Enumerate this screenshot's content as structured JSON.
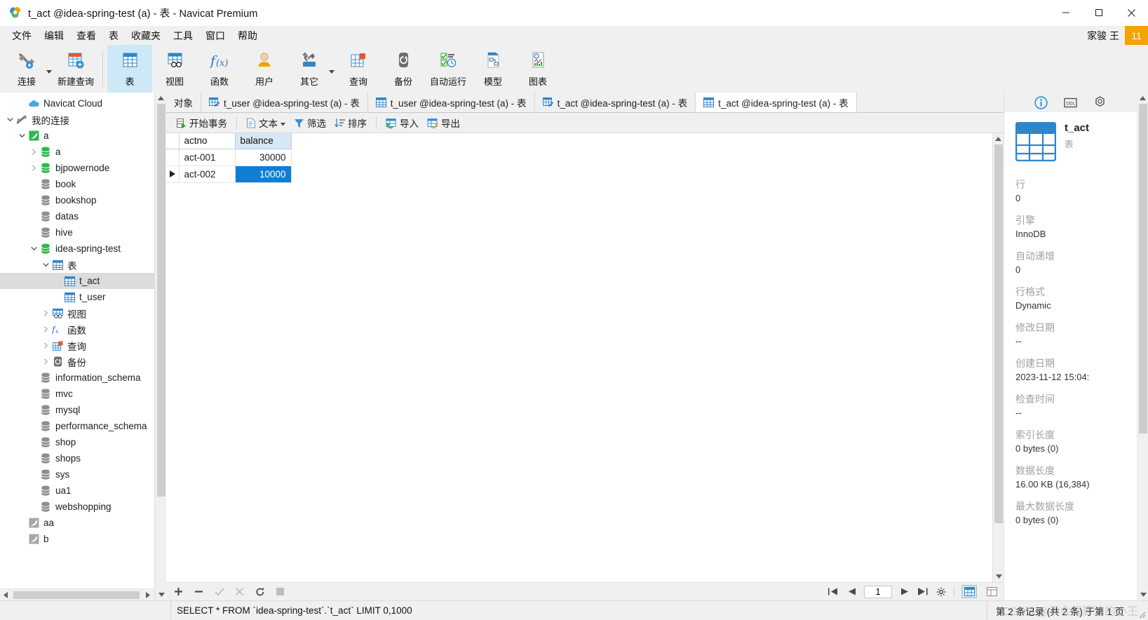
{
  "window": {
    "title": "t_act @idea-spring-test (a) - 表 - Navicat Premium",
    "minimize": "minimize-button",
    "maximize": "maximize-button",
    "close": "close-button"
  },
  "menubar": {
    "items": [
      "文件",
      "编辑",
      "查看",
      "表",
      "收藏夹",
      "工具",
      "窗口",
      "帮助"
    ],
    "user_name": "家骏 王",
    "user_badge": "11"
  },
  "toolbar": {
    "groups": [
      [
        {
          "label": "连接",
          "icon": "connection-icon",
          "caret": true,
          "active": false
        },
        {
          "label": "新建查询",
          "icon": "new-query-icon",
          "caret": false,
          "active": false
        }
      ],
      [
        {
          "label": "表",
          "icon": "table-icon",
          "caret": false,
          "active": true
        },
        {
          "label": "视图",
          "icon": "view-icon",
          "caret": false,
          "active": false
        },
        {
          "label": "函数",
          "icon": "function-icon",
          "caret": false,
          "active": false
        },
        {
          "label": "用户",
          "icon": "user-icon",
          "caret": false,
          "active": false
        },
        {
          "label": "其它",
          "icon": "other-tools-icon",
          "caret": true,
          "active": false
        },
        {
          "label": "查询",
          "icon": "query-icon",
          "caret": false,
          "active": false
        },
        {
          "label": "备份",
          "icon": "backup-icon",
          "caret": false,
          "active": false
        },
        {
          "label": "自动运行",
          "icon": "automation-icon",
          "caret": false,
          "active": false
        },
        {
          "label": "模型",
          "icon": "model-icon",
          "caret": false,
          "active": false
        },
        {
          "label": "图表",
          "icon": "chart-icon",
          "caret": false,
          "active": false
        }
      ]
    ]
  },
  "sidebar": {
    "tree": [
      {
        "label": "Navicat Cloud",
        "indent": 1,
        "icon": "cloud-icon",
        "twist": "none",
        "selected": false
      },
      {
        "label": "我的连接",
        "indent": 0,
        "icon": "connections-icon",
        "twist": "down",
        "selected": false
      },
      {
        "label": "a",
        "indent": 1,
        "icon": "mysql-connection-icon",
        "twist": "down",
        "selected": false
      },
      {
        "label": "a",
        "indent": 2,
        "icon": "database-green-icon",
        "twist": "right",
        "selected": false
      },
      {
        "label": "bjpowernode",
        "indent": 2,
        "icon": "database-green-icon",
        "twist": "right",
        "selected": false
      },
      {
        "label": "book",
        "indent": 2,
        "icon": "database-gray-icon",
        "twist": "none",
        "selected": false
      },
      {
        "label": "bookshop",
        "indent": 2,
        "icon": "database-gray-icon",
        "twist": "none",
        "selected": false
      },
      {
        "label": "datas",
        "indent": 2,
        "icon": "database-gray-icon",
        "twist": "none",
        "selected": false
      },
      {
        "label": "hive",
        "indent": 2,
        "icon": "database-gray-icon",
        "twist": "none",
        "selected": false
      },
      {
        "label": "idea-spring-test",
        "indent": 2,
        "icon": "database-green-icon",
        "twist": "down",
        "selected": false
      },
      {
        "label": "表",
        "indent": 3,
        "icon": "tables-folder-icon",
        "twist": "down",
        "selected": false
      },
      {
        "label": "t_act",
        "indent": 4,
        "icon": "table-small-icon",
        "twist": "none",
        "selected": true
      },
      {
        "label": "t_user",
        "indent": 4,
        "icon": "table-small-icon",
        "twist": "none",
        "selected": false
      },
      {
        "label": "视图",
        "indent": 3,
        "icon": "views-folder-icon",
        "twist": "right",
        "selected": false
      },
      {
        "label": "函数",
        "indent": 3,
        "icon": "functions-folder-icon",
        "twist": "right",
        "selected": false
      },
      {
        "label": "查询",
        "indent": 3,
        "icon": "queries-folder-icon",
        "twist": "right",
        "selected": false
      },
      {
        "label": "备份",
        "indent": 3,
        "icon": "backups-folder-icon",
        "twist": "right",
        "selected": false
      },
      {
        "label": "information_schema",
        "indent": 2,
        "icon": "database-gray-icon",
        "twist": "none",
        "selected": false
      },
      {
        "label": "mvc",
        "indent": 2,
        "icon": "database-gray-icon",
        "twist": "none",
        "selected": false
      },
      {
        "label": "mysql",
        "indent": 2,
        "icon": "database-gray-icon",
        "twist": "none",
        "selected": false
      },
      {
        "label": "performance_schema",
        "indent": 2,
        "icon": "database-gray-icon",
        "twist": "none",
        "selected": false
      },
      {
        "label": "shop",
        "indent": 2,
        "icon": "database-gray-icon",
        "twist": "none",
        "selected": false
      },
      {
        "label": "shops",
        "indent": 2,
        "icon": "database-gray-icon",
        "twist": "none",
        "selected": false
      },
      {
        "label": "sys",
        "indent": 2,
        "icon": "database-gray-icon",
        "twist": "none",
        "selected": false
      },
      {
        "label": "ua1",
        "indent": 2,
        "icon": "database-gray-icon",
        "twist": "none",
        "selected": false
      },
      {
        "label": "webshopping",
        "indent": 2,
        "icon": "database-gray-icon",
        "twist": "none",
        "selected": false
      },
      {
        "label": "aa",
        "indent": 1,
        "icon": "mysql-connection-gray-icon",
        "twist": "none",
        "selected": false
      },
      {
        "label": "b",
        "indent": 1,
        "icon": "mysql-connection-gray-icon",
        "twist": "none",
        "selected": false
      }
    ]
  },
  "tabs": [
    {
      "label": "对象",
      "icon": "none",
      "active": false
    },
    {
      "label": "t_user @idea-spring-test (a) - 表",
      "icon": "table-design-icon",
      "active": false
    },
    {
      "label": "t_user @idea-spring-test (a) - 表",
      "icon": "table-data-icon",
      "active": false
    },
    {
      "label": "t_act @idea-spring-test (a) - 表",
      "icon": "table-design-icon",
      "active": false
    },
    {
      "label": "t_act @idea-spring-test (a) - 表",
      "icon": "table-data-icon",
      "active": true
    }
  ],
  "grid_toolbar": [
    {
      "label": "开始事务",
      "icon": "transaction-icon",
      "caret": false
    },
    {
      "label": "文本",
      "icon": "text-icon",
      "caret": true
    },
    {
      "label": "筛选",
      "icon": "filter-icon",
      "caret": false
    },
    {
      "label": "排序",
      "icon": "sort-icon",
      "caret": false
    },
    {
      "label": "导入",
      "icon": "import-icon",
      "caret": false
    },
    {
      "label": "导出",
      "icon": "export-icon",
      "caret": false
    }
  ],
  "grid": {
    "columns": [
      "actno",
      "balance"
    ],
    "selected_column": "balance",
    "rows": [
      {
        "actno": "act-001",
        "balance": "30000",
        "current": false,
        "selected_cell": null
      },
      {
        "actno": "act-002",
        "balance": "10000",
        "current": true,
        "selected_cell": "balance"
      }
    ]
  },
  "editbar": {
    "buttons": [
      {
        "name": "add-record-button",
        "glyph": "+",
        "enabled": true
      },
      {
        "name": "delete-record-button",
        "glyph": "−",
        "enabled": true
      },
      {
        "name": "apply-change-button",
        "glyph": "✓",
        "enabled": false
      },
      {
        "name": "cancel-change-button",
        "glyph": "✗",
        "enabled": false
      },
      {
        "name": "refresh-button",
        "glyph": "↻",
        "enabled": true
      },
      {
        "name": "stop-button",
        "glyph": "■",
        "enabled": false
      }
    ]
  },
  "pager": {
    "first": "first-page-button",
    "prev": "previous-page-button",
    "page_value": "1",
    "next": "next-page-button",
    "last": "last-page-button",
    "settings": "page-settings-button",
    "grid_view": "grid-view-button",
    "form_view": "form-view-button"
  },
  "infopanel": {
    "tabs": [
      {
        "name": "info-tab",
        "icon": "info-icon",
        "active": true
      },
      {
        "name": "ddl-tab",
        "icon": "ddl-icon",
        "active": false
      },
      {
        "name": "preview-tab",
        "icon": "gear-icon",
        "active": false
      }
    ],
    "object_name": "t_act",
    "object_type": "表",
    "properties": [
      {
        "key": "行",
        "value": "0"
      },
      {
        "key": "引擎",
        "value": "InnoDB"
      },
      {
        "key": "自动递增",
        "value": "0"
      },
      {
        "key": "行格式",
        "value": "Dynamic"
      },
      {
        "key": "修改日期",
        "value": "--"
      },
      {
        "key": "创建日期",
        "value": "2023-11-12 15:04:"
      },
      {
        "key": "检查时间",
        "value": "--"
      },
      {
        "key": "索引长度",
        "value": "0 bytes (0)"
      },
      {
        "key": "数据长度",
        "value": "16.00 KB (16,384)"
      },
      {
        "key": "最大数据长度",
        "value": "0 bytes (0)"
      }
    ]
  },
  "statusbar": {
    "sql": "SELECT * FROM `idea-spring-test`.`t_act` LIMIT 0,1000",
    "record_info": "第 2 条记录 (共 2 条) 于第 1 页",
    "watermark": "CSDN @不会写算法的小王"
  },
  "colors": {
    "accent_blue": "#0f7fd4",
    "header_blue": "#d7e7f4",
    "badge_orange": "#f5a300",
    "selection_gray": "#dcdcdc"
  }
}
